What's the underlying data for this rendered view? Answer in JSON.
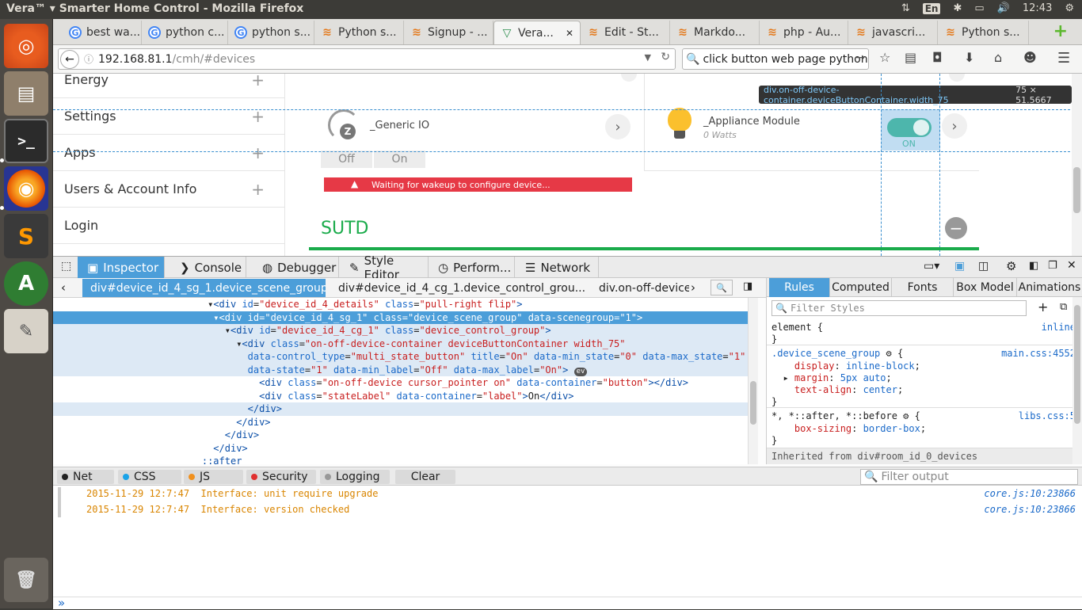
{
  "window": {
    "title": "Vera™ ▾ Smarter Home Control - Mozilla Firefox",
    "clock": "12:43",
    "keyboard": "En"
  },
  "tabs": [
    {
      "label": "best wa...",
      "icon": "google"
    },
    {
      "label": "python c...",
      "icon": "google"
    },
    {
      "label": "python s...",
      "icon": "google"
    },
    {
      "label": "Python s...",
      "icon": "stackoverflow"
    },
    {
      "label": "Signup - ...",
      "icon": "stackoverflow"
    },
    {
      "label": "Vera...",
      "icon": "vera",
      "active": true
    },
    {
      "label": "Edit - St...",
      "icon": "stackoverflow"
    },
    {
      "label": "Markdo...",
      "icon": "stackoverflow"
    },
    {
      "label": "php - Au...",
      "icon": "stackoverflow"
    },
    {
      "label": "javascri...",
      "icon": "stackoverflow"
    },
    {
      "label": "Python s...",
      "icon": "stackoverflow"
    }
  ],
  "nav": {
    "url_host": "192.168.81.1",
    "url_path": "/cmh/#devices",
    "search_value": "click button web page python"
  },
  "sidebar": [
    "Energy",
    "Settings",
    "Apps",
    "Users & Account Info",
    "Login"
  ],
  "devices": {
    "generic": {
      "name": "_Generic IO",
      "off": "Off",
      "on": "On",
      "warning": "Waiting for wakeup to configure device..."
    },
    "appliance": {
      "name": "_Appliance Module",
      "watts": "0 Watts",
      "state": "ON"
    },
    "room": "SUTD",
    "tooltip": {
      "selector": "div.on-off-device-container.deviceButtonContainer.width_75",
      "size": "75 × 51.5667"
    }
  },
  "devtools": {
    "tabs": [
      "Inspector",
      "Console",
      "Debugger",
      "Style Editor",
      "Perform...",
      "Network"
    ],
    "crumbs": [
      "div#device_id_4_sg_1.device_scene_group",
      "div#device_id_4_cg_1.device_control_grou...",
      "div.on-off-device"
    ],
    "rule_tabs": [
      "Rules",
      "Computed",
      "Fonts",
      "Box Model",
      "Animations"
    ],
    "filter_styles": "Filter Styles",
    "inherited": "Inherited from div#room_id_0_devices",
    "after": "::after"
  },
  "console": {
    "filters": [
      "Net",
      "CSS",
      "JS",
      "Security",
      "Logging"
    ],
    "clear": "Clear",
    "filter_output": "Filter output",
    "logs": [
      {
        "time": "2015-11-29 12:7:47",
        "msg": "Interface: unit require upgrade",
        "src": "core.js:10:23866"
      },
      {
        "time": "2015-11-29 12:7:47",
        "msg": "Interface: version checked",
        "src": "core.js:10:23866"
      }
    ],
    "prompt": "»"
  },
  "colors": {
    "accent": "#4c9ed9",
    "room_line": "#1aab4b",
    "warning": "#e63946",
    "toggle_on": "#4db6ac"
  }
}
